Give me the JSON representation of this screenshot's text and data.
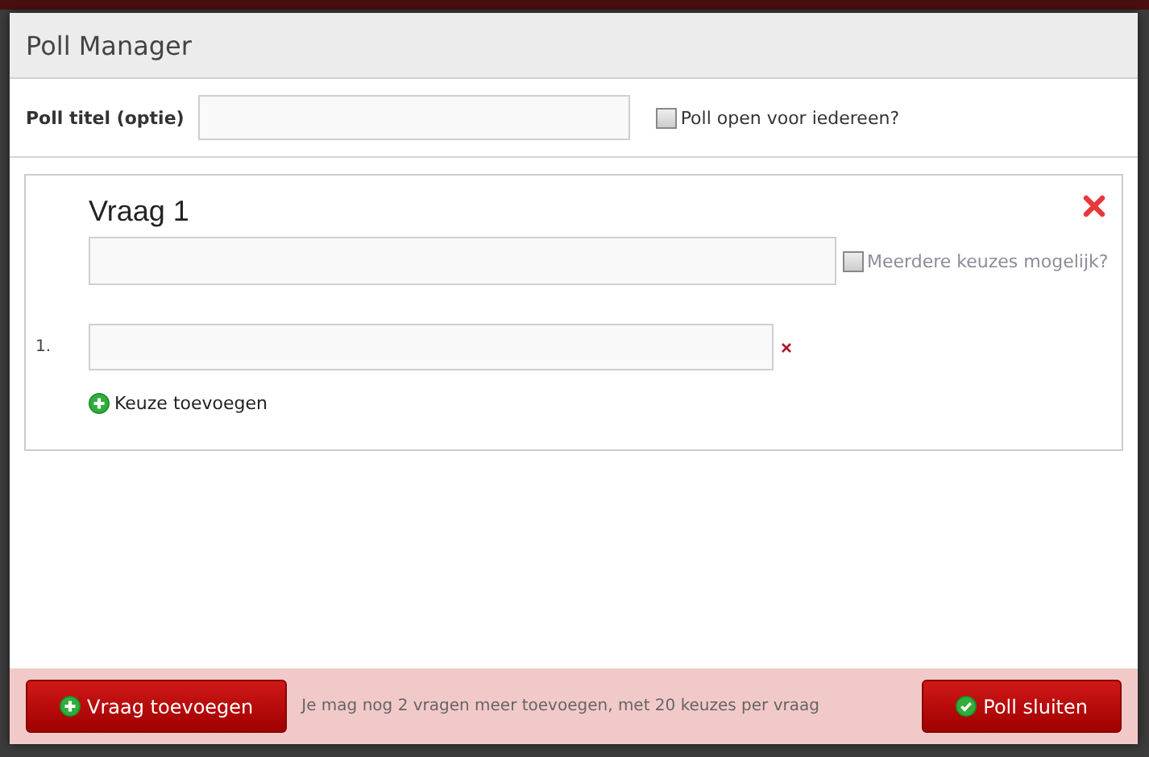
{
  "window": {
    "title": "Poll Manager"
  },
  "poll": {
    "title_label": "Poll titel (optie)",
    "open_label": "Poll open voor iedereen?",
    "open_checked": false
  },
  "questions": [
    {
      "heading": "Vraag 1",
      "multiple_label": "Meerdere keuzes mogelijk?",
      "multiple_checked": false,
      "options": [
        {
          "number": "1."
        }
      ],
      "add_option": "Keuze toevoegen"
    }
  ],
  "footer": {
    "add_button": "Vraag toevoegen",
    "info": "Je mag nog 2 vragen meer toevoegen, met 20 keuzes per vraag",
    "close_button": "Poll sluiten"
  }
}
